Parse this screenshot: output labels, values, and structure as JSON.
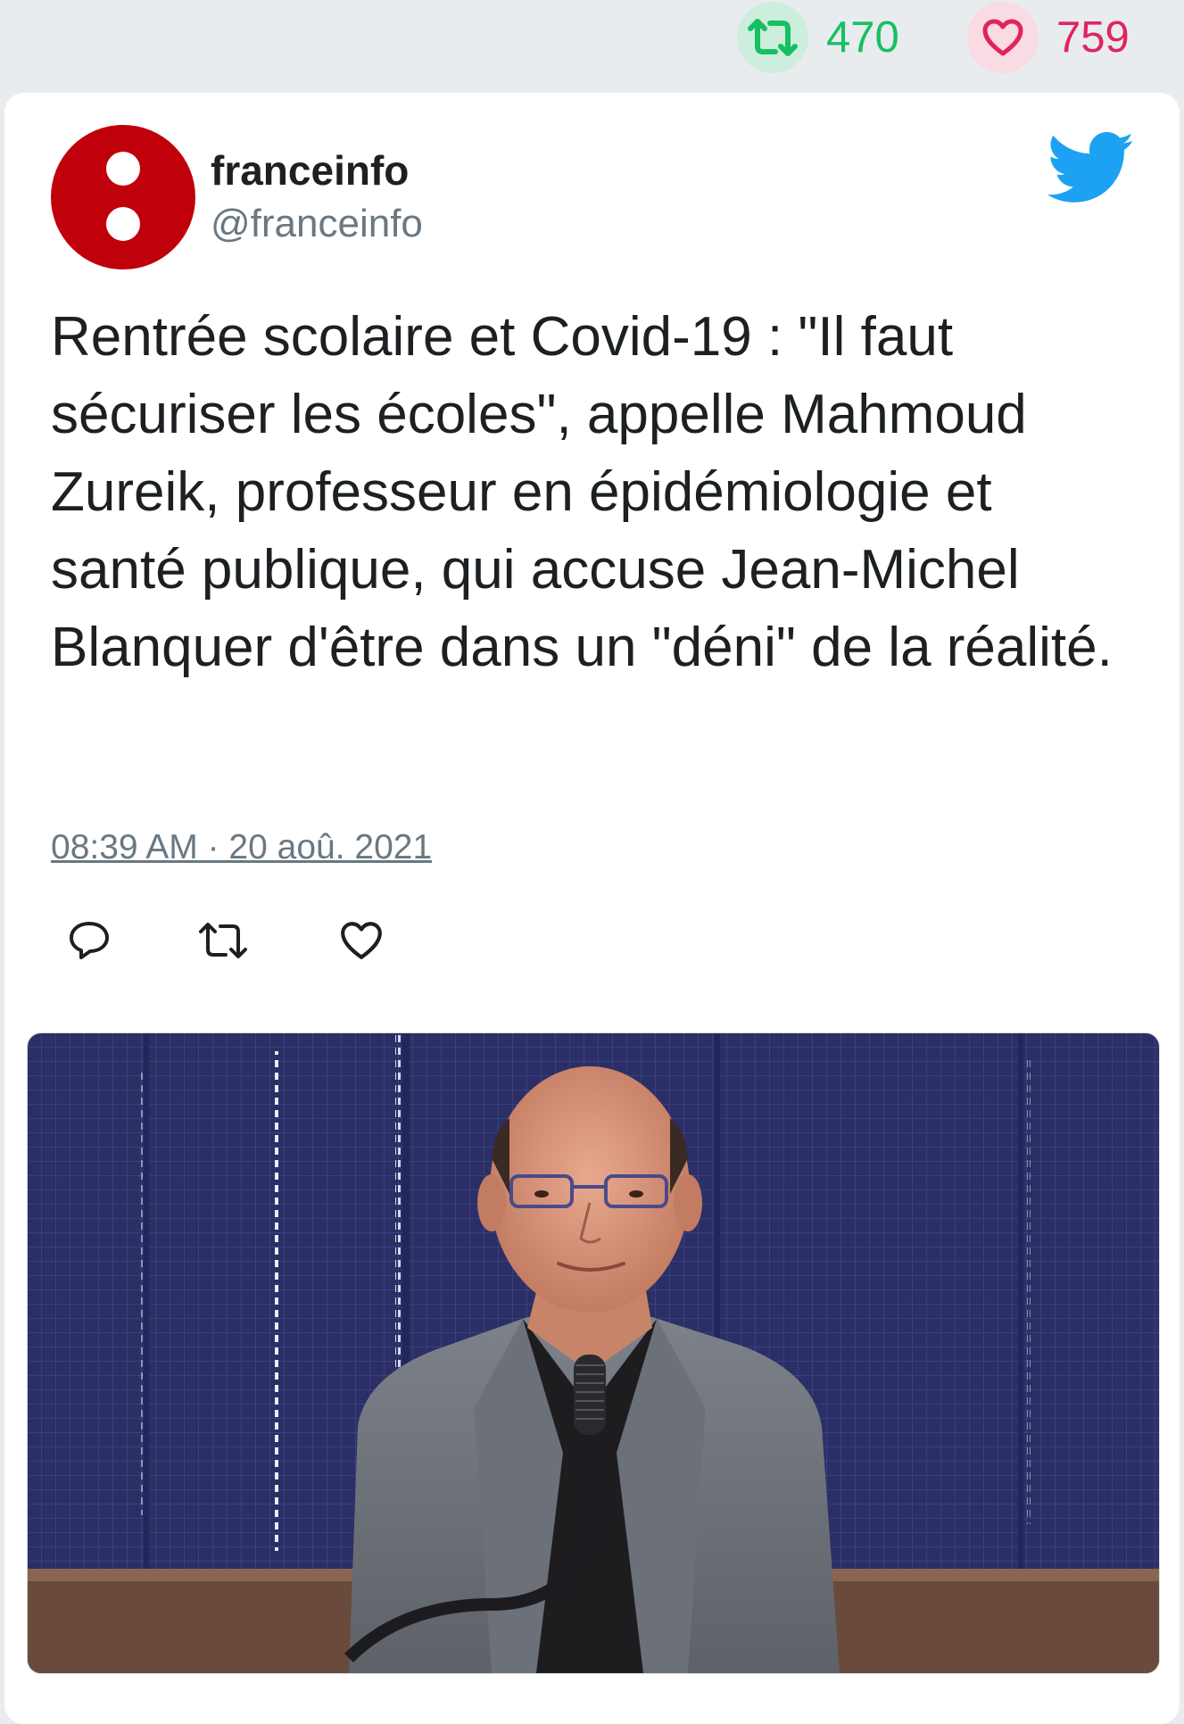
{
  "stats": {
    "retweets": "470",
    "likes": "759",
    "retweet_icon": "retweet-icon",
    "like_icon": "heart-icon",
    "retweet_color": "#17bf63",
    "like_color": "#e0245e"
  },
  "tweet": {
    "display_name": "franceinfo",
    "handle": "@franceinfo",
    "avatar_color": "#c0000b",
    "text": "Rentrée scolaire et Covid-19 : \"Il faut sécuriser les écoles\", appelle Mahmoud Zureik, professeur en épidémiologie et santé publique, qui accuse Jean-Michel Blanquer d'être dans un \"déni\" de la réalité.",
    "timestamp": "08:39 AM · 20 aoû. 2021",
    "brand_icon": "twitter-bird-icon",
    "brand_color": "#1da1f2"
  },
  "actions": [
    {
      "name": "reply",
      "icon": "reply-icon"
    },
    {
      "name": "retweet",
      "icon": "retweet-icon"
    },
    {
      "name": "like",
      "icon": "heart-icon"
    }
  ],
  "media": {
    "type": "photo",
    "background_color": "#2a2d62"
  }
}
